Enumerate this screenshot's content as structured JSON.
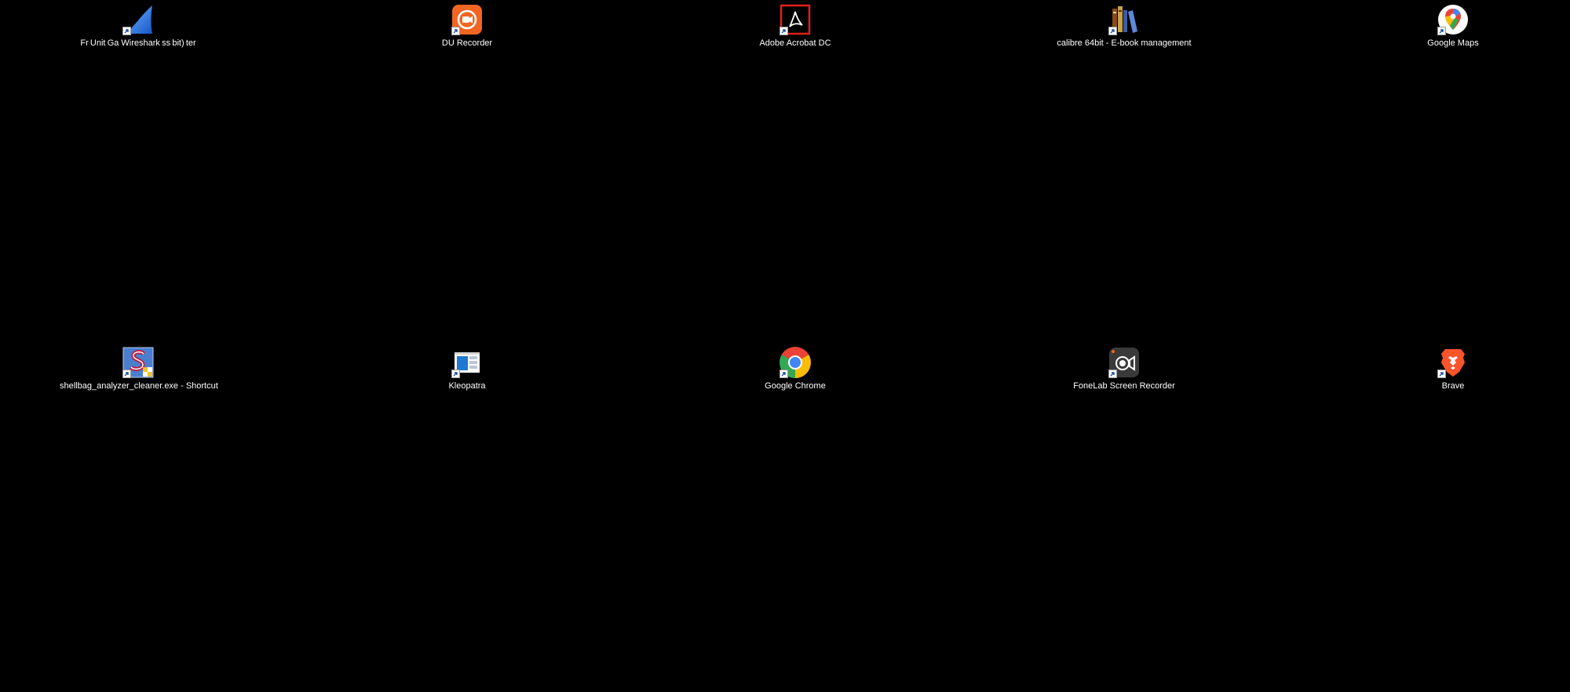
{
  "desktop": {
    "background_color": "#000000",
    "icons": [
      {
        "label": "Fr Unit Ga Wireshark ss bit) ter",
        "icon": "wireshark-fin-icon"
      },
      {
        "label": "DU Recorder",
        "icon": "du-recorder-icon"
      },
      {
        "label": "Adobe Acrobat DC",
        "icon": "adobe-acrobat-icon"
      },
      {
        "label": "calibre 64bit - E-book management",
        "icon": "calibre-books-icon"
      },
      {
        "label": "Google Maps",
        "icon": "google-maps-pin-icon"
      },
      {
        "label": "shellbag_analyzer_cleaner.exe - Shortcut",
        "icon": "shellbag-analyzer-icon"
      },
      {
        "label": "Kleopatra",
        "icon": "kleopatra-icon"
      },
      {
        "label": "Google Chrome",
        "icon": "google-chrome-icon"
      },
      {
        "label": "FoneLab Screen Recorder",
        "icon": "fonelab-recorder-icon"
      },
      {
        "label": "Brave",
        "icon": "brave-lion-icon"
      }
    ]
  },
  "colors": {
    "label_text": "#ffffff",
    "acrobat_red": "#e0201b",
    "du_orange": "#f26522",
    "brave_orange": "#fb542b"
  }
}
